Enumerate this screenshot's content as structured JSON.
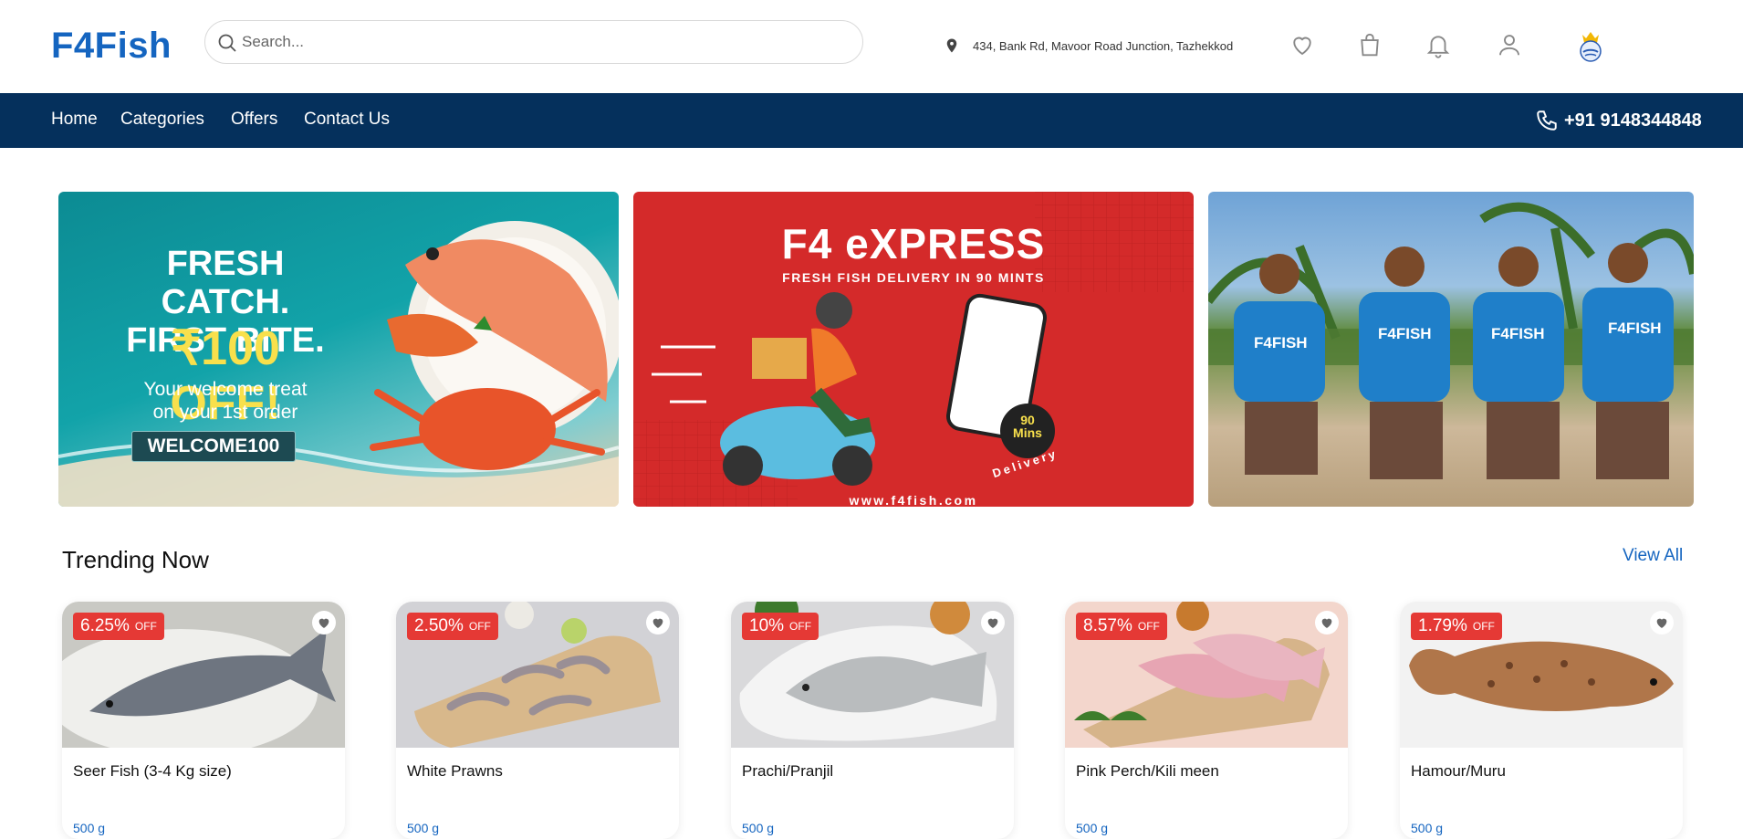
{
  "header": {
    "logo": "F4Fish",
    "search_placeholder": "Search...",
    "location": "434, Bank Rd, Mavoor Road Junction, Tazhekkod"
  },
  "nav": {
    "items": [
      "Home",
      "Categories",
      "Offers",
      "Contact Us"
    ],
    "phone": "+91 9148344848"
  },
  "banners": {
    "welcome": {
      "line1": "FRESH CATCH.",
      "line2": "FIRST BITE.",
      "offer": "₹100 OFF!",
      "treat1": "Your welcome treat",
      "treat2": "on your 1st order",
      "code": "WELCOME100"
    },
    "express": {
      "title": "F4 eXPRESS",
      "subtitle": "FRESH FISH DELIVERY IN 90 MINTS",
      "badge_num": "90",
      "badge_unit": "Mins",
      "badge_word": "Delivery",
      "url": "www.f4fish.com"
    },
    "team": {
      "shirt_text": "F4FISH"
    }
  },
  "trending": {
    "title": "Trending Now",
    "view_all": "View All",
    "off_label": "OFF",
    "products": [
      {
        "discount": "6.25%",
        "name": "Seer Fish (3-4 Kg size)",
        "weight": "500 g"
      },
      {
        "discount": "2.50%",
        "name": "White Prawns",
        "weight": "500 g"
      },
      {
        "discount": "10%",
        "name": "Prachi/Pranjil",
        "weight": "500 g"
      },
      {
        "discount": "8.57%",
        "name": "Pink Perch/Kili meen",
        "weight": "500 g"
      },
      {
        "discount": "1.79%",
        "name": "Hamour/Muru",
        "weight": "500 g"
      }
    ]
  },
  "colors": {
    "brand_blue": "#1565c0",
    "nav_bg": "#05305c",
    "discount_red": "#e53935"
  },
  "icons": [
    "search-icon",
    "location-pin-icon",
    "heart-icon",
    "shopping-bag-icon",
    "bell-icon",
    "user-icon",
    "phone-icon"
  ]
}
